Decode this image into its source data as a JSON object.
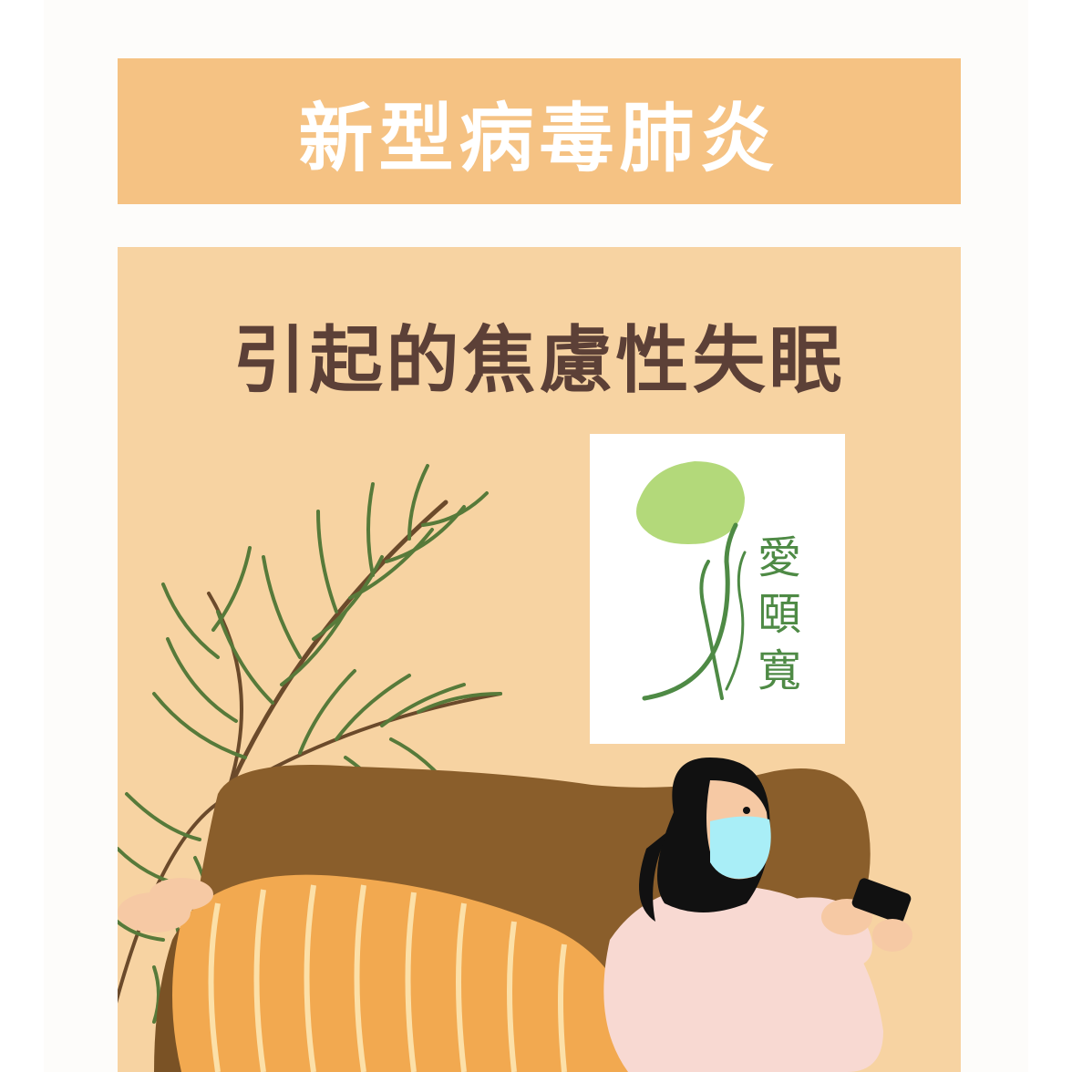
{
  "header": {
    "title": "新型病毒肺炎"
  },
  "main": {
    "subtitle": "引起的焦慮性失眠",
    "logo": {
      "chars": [
        "愛",
        "頤",
        "寬"
      ]
    }
  },
  "colors": {
    "banner": "#f5c283",
    "panel": "#f7d3a2",
    "subtitle": "#5c4037",
    "sofa": "#8a5e2b",
    "blanket": "#f2a950",
    "leaf": "#577a3a",
    "mask": "#a9eef7",
    "sweater": "#f8d9d2",
    "logo_green": "#b3d97a"
  },
  "illustration": {
    "subject": "woman-lying-on-sofa-with-phone",
    "icons": [
      "palm-plant-icon",
      "sofa-icon",
      "face-mask-icon",
      "phone-icon"
    ]
  }
}
